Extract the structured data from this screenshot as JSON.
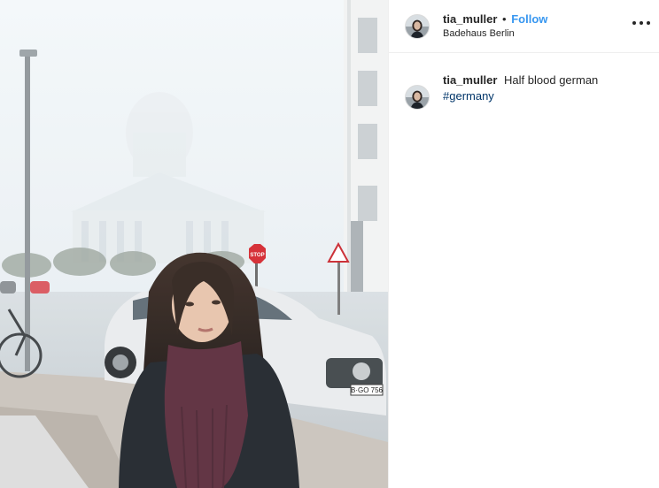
{
  "post": {
    "username": "tia_muller",
    "separator": "•",
    "follow_label": "Follow",
    "location": "Badehaus Berlin",
    "more_icon": "more-horizontal-icon",
    "caption": {
      "username": "tia_muller",
      "text": "Half blood german",
      "hashtag": "#germany"
    },
    "photo": {
      "stop_sign_text": "STOP",
      "license_plate": "B·GO 756"
    }
  },
  "colors": {
    "follow_blue": "#3897f0",
    "hashtag_blue": "#003569",
    "text": "#262626",
    "divider": "#efefef"
  }
}
